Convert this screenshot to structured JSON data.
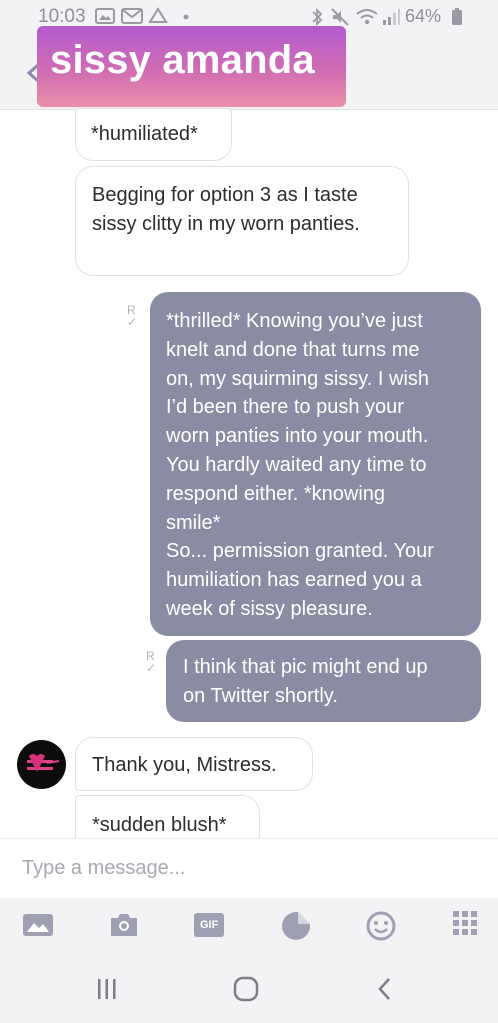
{
  "status_bar": {
    "time": "10:03",
    "battery": "64%"
  },
  "header": {
    "title": "sissy amanda",
    "back_icon": "arrow-left-icon"
  },
  "messages": [
    {
      "side": "in",
      "text": "*humiliated*"
    },
    {
      "side": "in",
      "text": "Begging for option 3 as I taste sissy clitty in my worn panties."
    },
    {
      "side": "out",
      "read_mark": "R",
      "lines": [
        "*thrilled* Knowing you’ve just",
        "knelt and done that turns me",
        "on, my squirming sissy. I wish",
        "I’d been there to push your",
        "worn panties into your mouth.",
        "You hardly waited any time to",
        "respond either. *knowing",
        "smile*",
        "So... permission granted. Your",
        "humiliation has earned you a",
        "week of sissy pleasure."
      ]
    },
    {
      "side": "out",
      "read_mark": "R",
      "lines": [
        "I think that pic might end up",
        "on Twitter shortly."
      ]
    },
    {
      "side": "in",
      "text": "Thank you, Mistress."
    },
    {
      "side": "in",
      "text": "*sudden blush*"
    }
  ],
  "composer": {
    "placeholder": "Type a message..."
  },
  "toolbar": {
    "gif_label": "GIF",
    "icons": [
      "gallery-icon",
      "camera-icon",
      "gif-icon",
      "sticker-icon",
      "emoji-icon",
      "apps-grid-icon"
    ]
  },
  "colors": {
    "outgoing_bubble": "#8a8ca4",
    "title_gradient_top": "#b35bd0",
    "title_gradient_bottom": "#e98fa8",
    "icon_color": "#9fa0b4"
  }
}
